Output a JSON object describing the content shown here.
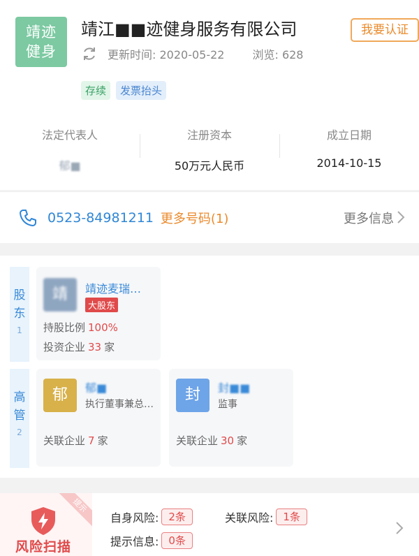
{
  "company": {
    "logo_line1": "靖迹",
    "logo_line2": "健身",
    "name": "靖江■■迹健身服务有限公司",
    "claim_button": "我要认证",
    "updated": "更新时间: 2020-05-22",
    "views": "浏览: 628",
    "tags": [
      "存续",
      "发票抬头"
    ]
  },
  "info": [
    {
      "label": "法定代表人",
      "value": "郁■"
    },
    {
      "label": "注册资本",
      "value": "50万元人民币"
    },
    {
      "label": "成立日期",
      "value": "2014-10-15"
    }
  ],
  "contact": {
    "phone": "0523-84981211",
    "more_numbers": "更多号码(1)",
    "more_info": "更多信息"
  },
  "shareholders": {
    "label_ch1": "股",
    "label_ch2": "东",
    "count": "1",
    "items": [
      {
        "avatar": "靖",
        "name": "靖迹麦瑞…",
        "badge": "大股东",
        "ratio_label": "持股比例",
        "ratio": "100%",
        "invest_label": "投资企业",
        "invest": "33",
        "unit": "家"
      }
    ]
  },
  "executives": {
    "label_ch1": "高",
    "label_ch2": "管",
    "count": "2",
    "items": [
      {
        "avatar": "郁",
        "name": "郁■",
        "role": "执行董事兼总…",
        "link_label": "关联企业",
        "count": "7",
        "unit": "家"
      },
      {
        "avatar": "封",
        "name": "封■■",
        "role": "监事",
        "link_label": "关联企业",
        "count": "30",
        "unit": "家"
      }
    ]
  },
  "risk": {
    "hint": "提示",
    "title": "风险扫描",
    "self_label": "自身风险:",
    "self_count": "2条",
    "related_label": "关联风险:",
    "related_count": "1条",
    "info_label": "提示信息:",
    "info_count": "0条"
  },
  "colors": {
    "accent_blue": "#2f86d6",
    "accent_orange": "#ea8a2c",
    "risk_red": "#e04a4a"
  }
}
